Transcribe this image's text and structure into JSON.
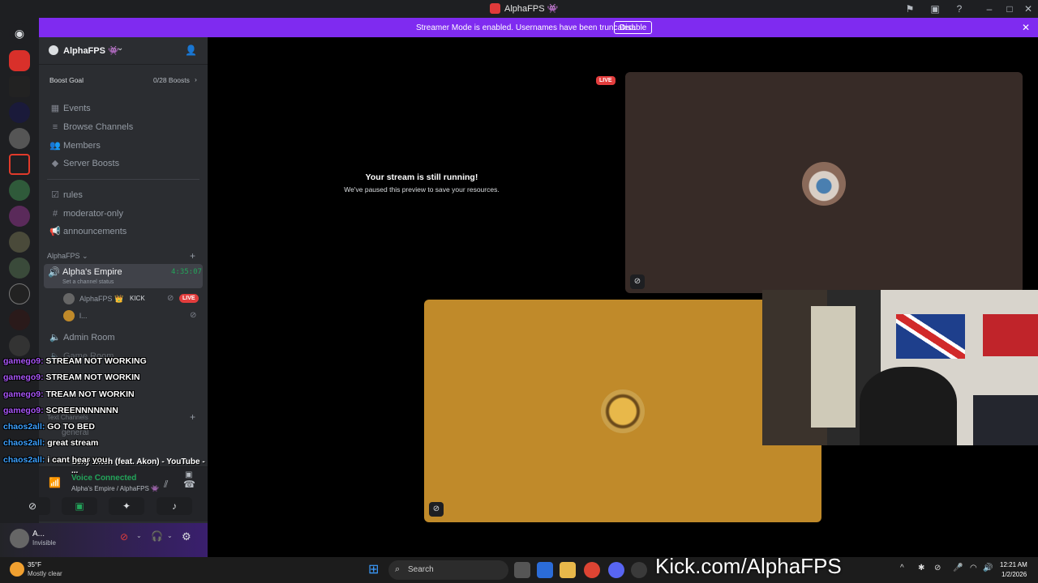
{
  "window": {
    "title": "AlphaFPS 👾"
  },
  "banner": {
    "message": "Streamer Mode is enabled. Usernames have been truncated.",
    "disable_label": "Disable"
  },
  "server": {
    "name": "AlphaFPS 👾",
    "boost_goal_label": "Boost Goal",
    "boost_count": "0/28 Boosts"
  },
  "nav": {
    "events": "Events",
    "browse": "Browse Channels",
    "members": "Members",
    "boosts": "Server Boosts"
  },
  "channels": {
    "rules": "rules",
    "moderator": "moderator-only",
    "announcements": "announcements"
  },
  "category": {
    "name": "AlphaFPS"
  },
  "voice_channel": {
    "name": "Alpha's Empire",
    "timer": "4:35:07",
    "status_hint": "Set a channel status",
    "user1": "AlphaFPS 👑",
    "user1_tag": "KICK",
    "live_badge": "LIVE",
    "user2": "l..."
  },
  "other_channels": {
    "admin": "Admin Room",
    "game": "Game Room",
    "text_category": "Text Channels",
    "general": "general"
  },
  "voice_panel": {
    "status": "Voice Connected",
    "location": "Alpha's Empire / AlphaFPS 👾",
    "now_playing": "Sexy Bitch (feat. Akon) - YouTube - ..."
  },
  "user_panel": {
    "name": "A...",
    "status": "Invisible"
  },
  "stream": {
    "title": "Your stream is still running!",
    "subtitle": "We've paused this preview to save your resources.",
    "live_badge": "LIVE"
  },
  "chat": [
    {
      "user": "gamego9:",
      "text": "STREAM NOT WORKING"
    },
    {
      "user": "gamego9:",
      "text": "STREAM NOT WORKIN"
    },
    {
      "user": "gamego9:",
      "text": "TREAM NOT WORKIN"
    },
    {
      "user": "gamego9:",
      "text": "SCREENNNNNNN"
    },
    {
      "user": "chaos2all:",
      "text": "GO TO BED"
    },
    {
      "user": "chaos2all:",
      "text": "great stream"
    },
    {
      "user": "chaos2all:",
      "text": "i cant hear you"
    }
  ],
  "overlay": {
    "kick_url": "Kick.com/AlphaFPS"
  },
  "taskbar": {
    "weather_temp": "35°F",
    "weather_desc": "Mostly clear",
    "search": "Search",
    "time": "12:21 AM",
    "date": "1/2/2026"
  },
  "colors": {
    "accent": "#7f2bf0",
    "live": "#e23d3d",
    "connected": "#23a55a",
    "kick": "#53fc18"
  }
}
